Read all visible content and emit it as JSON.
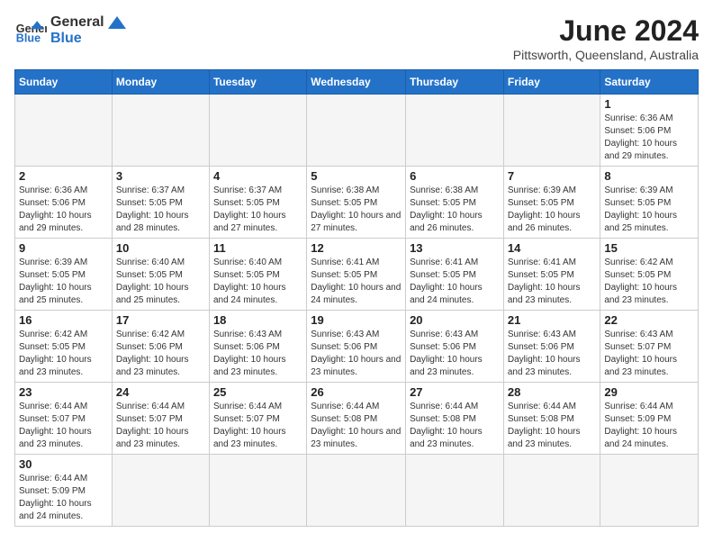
{
  "header": {
    "logo_general": "General",
    "logo_blue": "Blue",
    "month_title": "June 2024",
    "location": "Pittsworth, Queensland, Australia"
  },
  "weekdays": [
    "Sunday",
    "Monday",
    "Tuesday",
    "Wednesday",
    "Thursday",
    "Friday",
    "Saturday"
  ],
  "weeks": [
    [
      {
        "day": "",
        "info": ""
      },
      {
        "day": "",
        "info": ""
      },
      {
        "day": "",
        "info": ""
      },
      {
        "day": "",
        "info": ""
      },
      {
        "day": "",
        "info": ""
      },
      {
        "day": "",
        "info": ""
      },
      {
        "day": "1",
        "info": "Sunrise: 6:36 AM\nSunset: 5:06 PM\nDaylight: 10 hours and 29 minutes."
      }
    ],
    [
      {
        "day": "2",
        "info": "Sunrise: 6:36 AM\nSunset: 5:06 PM\nDaylight: 10 hours and 29 minutes."
      },
      {
        "day": "3",
        "info": "Sunrise: 6:37 AM\nSunset: 5:05 PM\nDaylight: 10 hours and 28 minutes."
      },
      {
        "day": "4",
        "info": "Sunrise: 6:37 AM\nSunset: 5:05 PM\nDaylight: 10 hours and 27 minutes."
      },
      {
        "day": "5",
        "info": "Sunrise: 6:38 AM\nSunset: 5:05 PM\nDaylight: 10 hours and 27 minutes."
      },
      {
        "day": "6",
        "info": "Sunrise: 6:38 AM\nSunset: 5:05 PM\nDaylight: 10 hours and 26 minutes."
      },
      {
        "day": "7",
        "info": "Sunrise: 6:39 AM\nSunset: 5:05 PM\nDaylight: 10 hours and 26 minutes."
      },
      {
        "day": "8",
        "info": "Sunrise: 6:39 AM\nSunset: 5:05 PM\nDaylight: 10 hours and 25 minutes."
      }
    ],
    [
      {
        "day": "9",
        "info": "Sunrise: 6:39 AM\nSunset: 5:05 PM\nDaylight: 10 hours and 25 minutes."
      },
      {
        "day": "10",
        "info": "Sunrise: 6:40 AM\nSunset: 5:05 PM\nDaylight: 10 hours and 25 minutes."
      },
      {
        "day": "11",
        "info": "Sunrise: 6:40 AM\nSunset: 5:05 PM\nDaylight: 10 hours and 24 minutes."
      },
      {
        "day": "12",
        "info": "Sunrise: 6:41 AM\nSunset: 5:05 PM\nDaylight: 10 hours and 24 minutes."
      },
      {
        "day": "13",
        "info": "Sunrise: 6:41 AM\nSunset: 5:05 PM\nDaylight: 10 hours and 24 minutes."
      },
      {
        "day": "14",
        "info": "Sunrise: 6:41 AM\nSunset: 5:05 PM\nDaylight: 10 hours and 23 minutes."
      },
      {
        "day": "15",
        "info": "Sunrise: 6:42 AM\nSunset: 5:05 PM\nDaylight: 10 hours and 23 minutes."
      }
    ],
    [
      {
        "day": "16",
        "info": "Sunrise: 6:42 AM\nSunset: 5:05 PM\nDaylight: 10 hours and 23 minutes."
      },
      {
        "day": "17",
        "info": "Sunrise: 6:42 AM\nSunset: 5:06 PM\nDaylight: 10 hours and 23 minutes."
      },
      {
        "day": "18",
        "info": "Sunrise: 6:43 AM\nSunset: 5:06 PM\nDaylight: 10 hours and 23 minutes."
      },
      {
        "day": "19",
        "info": "Sunrise: 6:43 AM\nSunset: 5:06 PM\nDaylight: 10 hours and 23 minutes."
      },
      {
        "day": "20",
        "info": "Sunrise: 6:43 AM\nSunset: 5:06 PM\nDaylight: 10 hours and 23 minutes."
      },
      {
        "day": "21",
        "info": "Sunrise: 6:43 AM\nSunset: 5:06 PM\nDaylight: 10 hours and 23 minutes."
      },
      {
        "day": "22",
        "info": "Sunrise: 6:43 AM\nSunset: 5:07 PM\nDaylight: 10 hours and 23 minutes."
      }
    ],
    [
      {
        "day": "23",
        "info": "Sunrise: 6:44 AM\nSunset: 5:07 PM\nDaylight: 10 hours and 23 minutes."
      },
      {
        "day": "24",
        "info": "Sunrise: 6:44 AM\nSunset: 5:07 PM\nDaylight: 10 hours and 23 minutes."
      },
      {
        "day": "25",
        "info": "Sunrise: 6:44 AM\nSunset: 5:07 PM\nDaylight: 10 hours and 23 minutes."
      },
      {
        "day": "26",
        "info": "Sunrise: 6:44 AM\nSunset: 5:08 PM\nDaylight: 10 hours and 23 minutes."
      },
      {
        "day": "27",
        "info": "Sunrise: 6:44 AM\nSunset: 5:08 PM\nDaylight: 10 hours and 23 minutes."
      },
      {
        "day": "28",
        "info": "Sunrise: 6:44 AM\nSunset: 5:08 PM\nDaylight: 10 hours and 23 minutes."
      },
      {
        "day": "29",
        "info": "Sunrise: 6:44 AM\nSunset: 5:09 PM\nDaylight: 10 hours and 24 minutes."
      }
    ],
    [
      {
        "day": "30",
        "info": "Sunrise: 6:44 AM\nSunset: 5:09 PM\nDaylight: 10 hours and 24 minutes."
      },
      {
        "day": "",
        "info": ""
      },
      {
        "day": "",
        "info": ""
      },
      {
        "day": "",
        "info": ""
      },
      {
        "day": "",
        "info": ""
      },
      {
        "day": "",
        "info": ""
      },
      {
        "day": "",
        "info": ""
      }
    ]
  ]
}
